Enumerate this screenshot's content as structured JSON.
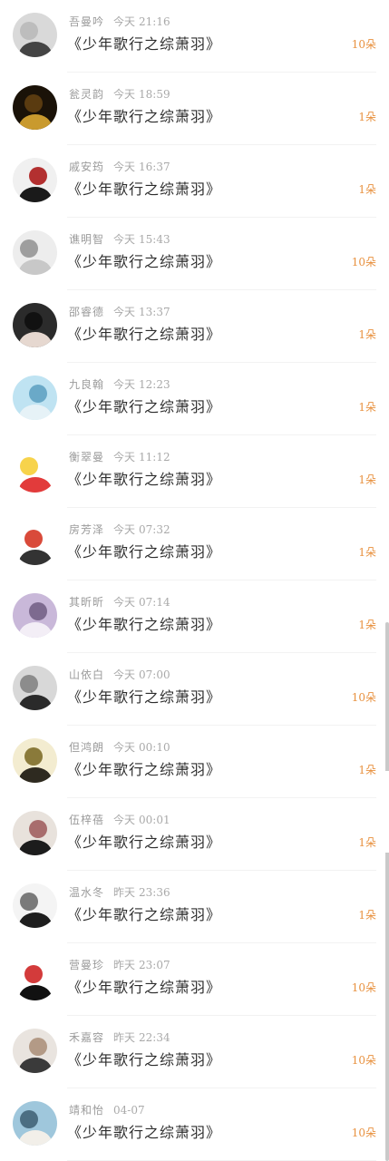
{
  "colors": {
    "accent": "#e8913f",
    "meta": "#a9a9a9",
    "title": "#2d2d2d"
  },
  "items": [
    {
      "name": "吾曼吟",
      "day": "今天",
      "time": "21:16",
      "title": "《少年歌行之综萧羽》",
      "count": "10朵",
      "avatar": "avatar-gray-portrait",
      "av": [
        "#d9d9d9",
        "#444444",
        "#bdbdbd"
      ]
    },
    {
      "name": "瓮灵韵",
      "day": "今天",
      "time": "18:59",
      "title": "《少年歌行之综萧羽》",
      "count": "1朵",
      "avatar": "avatar-dark-gold-mask",
      "av": [
        "#1a1208",
        "#c99a2e",
        "#5a3b10"
      ]
    },
    {
      "name": "戚安筠",
      "day": "今天",
      "time": "16:37",
      "title": "《少年歌行之综萧羽》",
      "count": "1朵",
      "avatar": "avatar-dark-portrait-red",
      "av": [
        "#f0f0f0",
        "#1a1a1a",
        "#b33030"
      ]
    },
    {
      "name": "谯明智",
      "day": "今天",
      "time": "15:43",
      "title": "《少年歌行之综萧羽》",
      "count": "10朵",
      "avatar": "avatar-ring",
      "av": [
        "#ededed",
        "#c8c8c8",
        "#9e9e9e"
      ]
    },
    {
      "name": "邵睿德",
      "day": "今天",
      "time": "13:37",
      "title": "《少年歌行之综萧羽》",
      "count": "1朵",
      "avatar": "avatar-doll",
      "av": [
        "#2b2b2b",
        "#e6d8d0",
        "#111111"
      ]
    },
    {
      "name": "九良翰",
      "day": "今天",
      "time": "12:23",
      "title": "《少年歌行之综萧羽》",
      "count": "1朵",
      "avatar": "avatar-sea",
      "av": [
        "#bfe3f2",
        "#e6f2f7",
        "#6aa9c8"
      ]
    },
    {
      "name": "衡翠曼",
      "day": "今天",
      "time": "11:12",
      "title": "《少年歌行之综萧羽》",
      "count": "1朵",
      "avatar": "avatar-cartoon-face",
      "av": [
        "#ffffff",
        "#e23b3b",
        "#f7d34b"
      ]
    },
    {
      "name": "房芳泽",
      "day": "今天",
      "time": "07:32",
      "title": "《少年歌行之综萧羽》",
      "count": "1朵",
      "avatar": "avatar-cartoon-head",
      "av": [
        "#ffffff",
        "#333333",
        "#d94a3a"
      ]
    },
    {
      "name": "其昕昕",
      "day": "今天",
      "time": "07:14",
      "title": "《少年歌行之综萧羽》",
      "count": "1朵",
      "avatar": "avatar-purple-figure",
      "av": [
        "#c9b8d9",
        "#f3eef6",
        "#7d6a8f"
      ]
    },
    {
      "name": "山依白",
      "day": "今天",
      "time": "07:00",
      "title": "《少年歌行之综萧羽》",
      "count": "10朵",
      "avatar": "avatar-girl-dark",
      "av": [
        "#d8d8d8",
        "#2a2a2a",
        "#8c8c8c"
      ]
    },
    {
      "name": "但鸿朗",
      "day": "今天",
      "time": "00:10",
      "title": "《少年歌行之综萧羽》",
      "count": "1朵",
      "avatar": "avatar-leaf-wreath",
      "av": [
        "#f3ecd0",
        "#2e2a20",
        "#8a7a3a"
      ]
    },
    {
      "name": "伍梓蓓",
      "day": "今天",
      "time": "00:01",
      "title": "《少年歌行之综萧羽》",
      "count": "1朵",
      "avatar": "avatar-girl-hair",
      "av": [
        "#e8e2dc",
        "#1c1c1c",
        "#a86d6d"
      ]
    },
    {
      "name": "温水冬",
      "day": "昨天",
      "time": "23:36",
      "title": "《少年歌行之综萧羽》",
      "count": "1朵",
      "avatar": "avatar-anime-sketch",
      "av": [
        "#f4f4f4",
        "#1e1e1e",
        "#7a7a7a"
      ]
    },
    {
      "name": "营曼珍",
      "day": "昨天",
      "time": "23:07",
      "title": "《少年歌行之综萧羽》",
      "count": "10朵",
      "avatar": "avatar-snoopy",
      "av": [
        "#ffffff",
        "#111111",
        "#d33b3b"
      ]
    },
    {
      "name": "禾嘉容",
      "day": "昨天",
      "time": "22:34",
      "title": "《少年歌行之综萧羽》",
      "count": "10朵",
      "avatar": "avatar-couple",
      "av": [
        "#e9e4df",
        "#3a3a3a",
        "#b39a86"
      ]
    },
    {
      "name": "靖和怡",
      "day": "",
      "time": "04-07",
      "title": "《少年歌行之综萧羽》",
      "count": "10朵",
      "avatar": "avatar-beach-girl",
      "av": [
        "#9fc7dc",
        "#f2efe9",
        "#4c6e82"
      ]
    }
  ]
}
